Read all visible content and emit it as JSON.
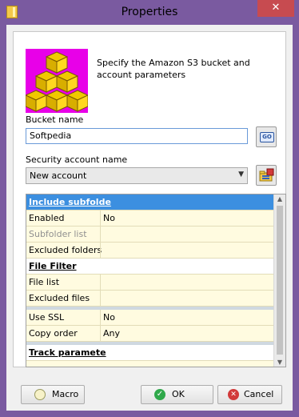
{
  "window": {
    "title": "Properties",
    "close_glyph": "✕",
    "app_icon": "folder-icon"
  },
  "header": {
    "description": "Specify the Amazon S3 bucket and account parameters",
    "logo_icon": "boxes-icon"
  },
  "bucket": {
    "label": "Bucket name",
    "value": "Softpedia",
    "go_label": "GO"
  },
  "account": {
    "label": "Security account name",
    "value": "New account",
    "browse_icon": "account-folder-icon"
  },
  "grid": {
    "rows": [
      {
        "type": "head",
        "key": "Include subfolde",
        "value": "",
        "selected": true
      },
      {
        "type": "item",
        "key": "Enabled",
        "value": "No"
      },
      {
        "type": "item",
        "key": "Subfolder list",
        "value": "",
        "disabled": true
      },
      {
        "type": "item",
        "key": "Excluded folders",
        "value": ""
      },
      {
        "type": "head",
        "key": "File Filter",
        "value": ""
      },
      {
        "type": "item",
        "key": "File list",
        "value": ""
      },
      {
        "type": "item",
        "key": "Excluded files",
        "value": ""
      },
      {
        "type": "sep"
      },
      {
        "type": "item",
        "key": "Use SSL",
        "value": "No"
      },
      {
        "type": "item",
        "key": "Copy order",
        "value": "Any"
      },
      {
        "type": "sep"
      },
      {
        "type": "head",
        "key": "Track paramete",
        "value": ""
      }
    ]
  },
  "buttons": {
    "macro": "Macro",
    "ok": "OK",
    "cancel": "Cancel"
  },
  "colors": {
    "frame": "#7a5aa0",
    "selection": "#3c8fe0",
    "grid_bg": "#fffbe0",
    "logo": "#e800e8",
    "box": "#f0c800",
    "close": "#c74b50"
  }
}
